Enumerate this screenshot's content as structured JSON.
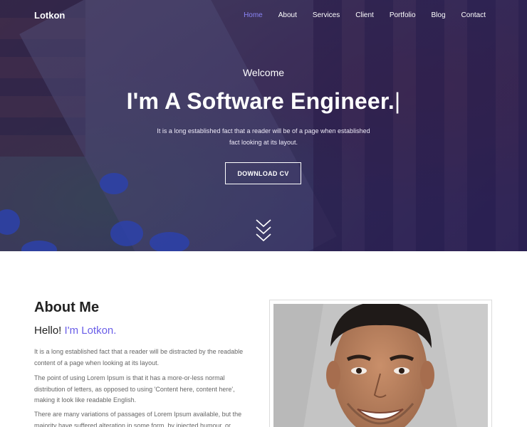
{
  "nav": {
    "logo": "Lotkon",
    "items": [
      {
        "label": "Home",
        "active": true
      },
      {
        "label": "About",
        "active": false
      },
      {
        "label": "Services",
        "active": false
      },
      {
        "label": "Client",
        "active": false
      },
      {
        "label": "Portfolio",
        "active": false
      },
      {
        "label": "Blog",
        "active": false
      },
      {
        "label": "Contact",
        "active": false
      }
    ]
  },
  "hero": {
    "welcome": "Welcome",
    "headline": "I'm A Software Engineer.",
    "cursor": "|",
    "subtitle": "It is a long established fact that a reader will be of a page when established fact looking at its layout.",
    "cta": "DOWNLOAD CV",
    "scroll_icon": "chevron-triple-down-icon"
  },
  "about": {
    "title": "About Me",
    "hello_prefix": "Hello!",
    "hello_name": "I'm Lotkon.",
    "paragraphs": [
      "It is a long established fact that a reader will be distracted by the readable content of a page when looking at its layout.",
      "The point of using Lorem Ipsum is that it has a more-or-less normal distribution of letters, as opposed to using 'Content here, content here', making it look like readable English.",
      "There are many variations of passages of Lorem Ipsum available, but the majority have suffered alteration in some form, by injected humour, or"
    ]
  },
  "colors": {
    "accent": "#6a5ee8",
    "hero_overlay": "#281e6e",
    "text_muted": "#666666"
  }
}
